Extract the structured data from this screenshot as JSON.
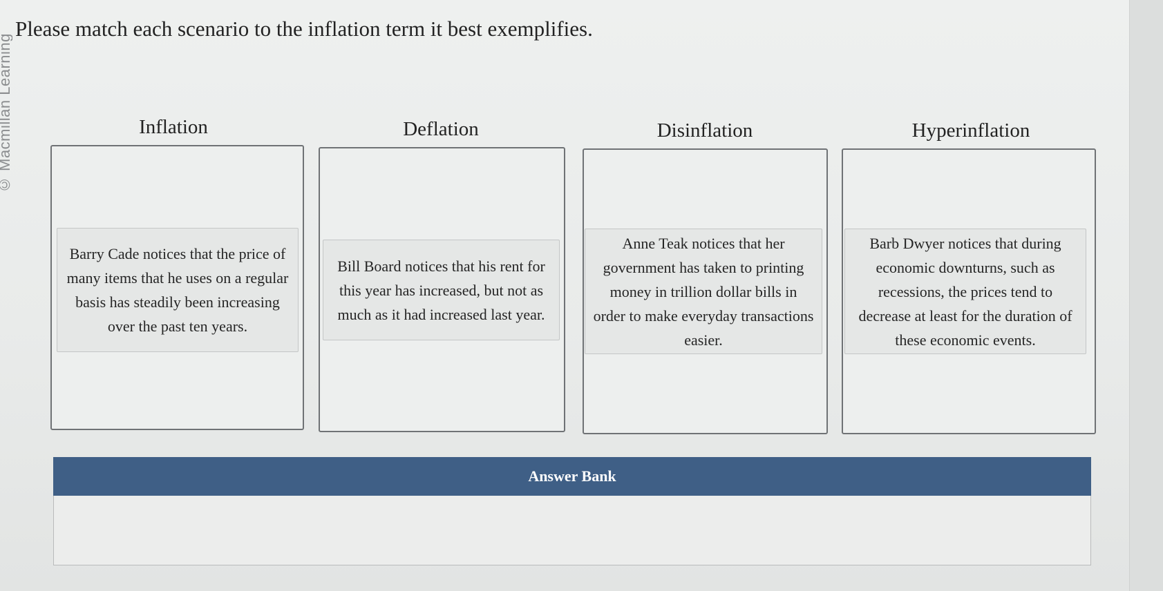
{
  "watermark": "© Macmillan Learning",
  "prompt": "Please match each scenario to the inflation term it best exemplifies.",
  "columns": [
    {
      "title": "Inflation",
      "card": "Barry Cade notices that the price of many items that he uses on a regular basis has steadily been increasing over the past ten years."
    },
    {
      "title": "Deflation",
      "card": "Bill Board notices that his rent for this year has increased, but not as much as it had increased last year."
    },
    {
      "title": "Disinflation",
      "card": "Anne Teak notices that her government has taken to printing money in trillion dollar bills in order to make everyday transactions easier."
    },
    {
      "title": "Hyperinflation",
      "card": "Barb Dwyer notices that during economic downturns, such as recessions, the prices tend to decrease at least for the duration of these economic events."
    }
  ],
  "answer_bank": {
    "label": "Answer Bank"
  }
}
